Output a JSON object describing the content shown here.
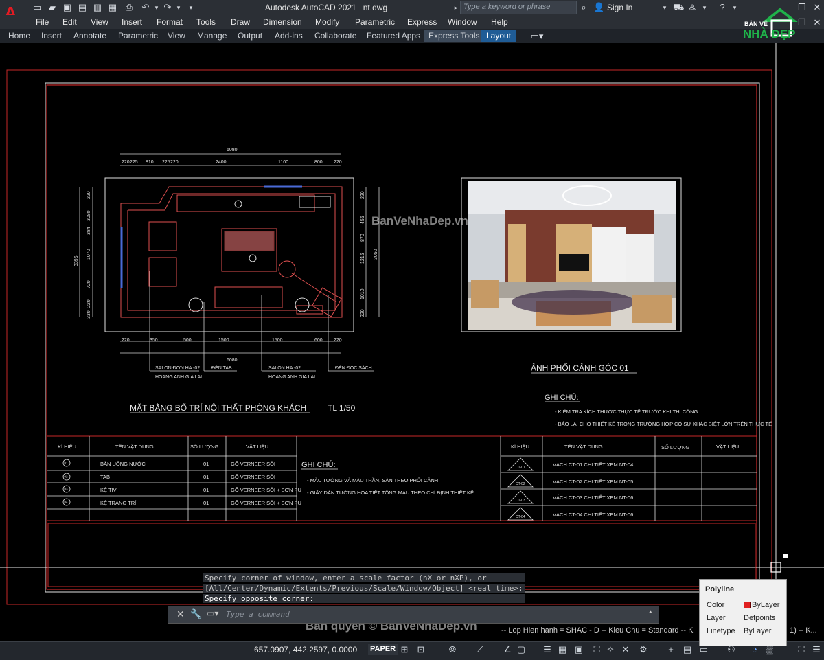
{
  "app": {
    "title": "Autodesk AutoCAD 2021   nt.dwg",
    "search_placeholder": "Type a keyword or phrase",
    "sign_in": "Sign In",
    "logo_letter": "A"
  },
  "menu": [
    "File",
    "Edit",
    "View",
    "Insert",
    "Format",
    "Tools",
    "Draw",
    "Dimension",
    "Modify",
    "Parametric",
    "Express",
    "Window",
    "Help"
  ],
  "ribbon_tabs": [
    "Home",
    "Insert",
    "Annotate",
    "Parametric",
    "View",
    "Manage",
    "Output",
    "Add-ins",
    "Collaborate",
    "Featured Apps",
    "Express Tools",
    "Layout"
  ],
  "drawing": {
    "top_dim": "6080",
    "bottom_dim": "6080",
    "top_dims": [
      "220",
      "225",
      "810",
      "225",
      "220",
      "2400",
      "1100",
      "800",
      "220"
    ],
    "bottom_dims": [
      "220",
      "350",
      "500",
      "1500",
      "1500",
      "600",
      "220"
    ],
    "left_dim": "3395",
    "left_dims": [
      "220",
      "3080",
      "384",
      "1070",
      "720",
      "220",
      "330"
    ],
    "right_dims": [
      "220",
      "455",
      "870",
      "1215",
      "1010",
      "220"
    ],
    "right_total": "3050",
    "callouts": [
      {
        "l1": "SALON ĐƠN HA -02",
        "l2": "HOANG ANH GIA LAI"
      },
      {
        "l1": "ĐÈN TAB",
        "l2": ""
      },
      {
        "l1": "SALON HA -02",
        "l2": "HOANG ANH GIA LAI"
      },
      {
        "l1": "ĐÈN ĐỌC SÁCH",
        "l2": ""
      }
    ],
    "plan_title": "MẶT BẰNG BỐ TRÍ NỘI THẤT PHÒNG KHÁCH",
    "plan_scale": "TL 1/50",
    "photo_title": "ẢNH PHỐI CẢNH GÓC 01",
    "note_title": "GHI CHÚ:",
    "notes_right": [
      "- KIỂM TRA KÍCH THƯỚC THỰC TẾ TRƯỚC KHI THI CÔNG",
      "- BÁO LẠI CHO THIẾT KẾ TRONG TRƯỜNG HỢP CÓ SỰ KHÁC BIỆT LỚN TRÊN THỰC TẾ"
    ],
    "notes_mid": [
      "- MÀU TƯỜNG VÀ MÀU TRẦN, SÀN THEO PHỐI CẢNH",
      "- GIẤY DÁN TƯỜNG HỌA TIẾT TÔNG MÀU THEO CHỈ ĐỊNH THIẾT KẾ"
    ],
    "table1_headers": [
      "KÍ HIỆU",
      "TÊN VẬT DỤNG",
      "SỐ LƯỢNG",
      "VẬT LIỆU"
    ],
    "table1_rows": [
      {
        "sym": "01",
        "name": "BÀN UỐNG NƯỚC",
        "qty": "01",
        "mat": "GỖ VERNEER SỒI"
      },
      {
        "sym": "02",
        "name": "TAB",
        "qty": "01",
        "mat": "GỖ VERNEER SỒI"
      },
      {
        "sym": "03",
        "name": "KỆ TIVI",
        "qty": "01",
        "mat": "GỖ VERNEER SỒI + SƠN PU"
      },
      {
        "sym": "04",
        "name": "KỆ TRANG TRÍ",
        "qty": "01",
        "mat": "GỖ VERNEER SỒI + SƠN PU"
      }
    ],
    "table2_headers": [
      "KÍ HIỆU",
      "TÊN VẬT DỤNG",
      "SỐ LƯỢNG",
      "VẬT LIỆU"
    ],
    "table2_rows": [
      {
        "sym": "CT-01",
        "name": "VÁCH CT-01 CHI TIẾT XEM NT-04"
      },
      {
        "sym": "CT-02",
        "name": "VÁCH CT-02 CHI TIẾT XEM NT-05"
      },
      {
        "sym": "CT-03",
        "name": "VÁCH CT-03 CHI TIẾT XEM NT-06"
      },
      {
        "sym": "CT-04",
        "name": "VÁCH CT-04 CHI TIẾT XEM NT-06"
      }
    ]
  },
  "watermark1": "BanVeNhaDep.vn",
  "watermark2": "Bản quyền © BanVeNhaDep.vn",
  "logo": {
    "l1": "BẢN VẼ",
    "l2": "NHÀ ĐẸP"
  },
  "command": {
    "line1": "Specify corner of window, enter a scale factor (nX or nXP), or",
    "line2": "[All/Center/Dynamic/Extents/Previous/Scale/Window/Object] <real time>:",
    "line3": "Specify opposite corner:",
    "placeholder": "Type a command"
  },
  "status": {
    "strip": "-- Lop Hien hanh = SHAC - D -- Kieu Chu = Standard -- K",
    "strip_end": "1) -- K...",
    "coords": "657.0907, 442.2597, 0.0000",
    "paper": "PAPER"
  },
  "props": {
    "title": "Polyline",
    "rows": [
      {
        "k": "Color",
        "v": "ByLayer"
      },
      {
        "k": "Layer",
        "v": "Defpoints"
      },
      {
        "k": "Linetype",
        "v": "ByLayer"
      }
    ]
  }
}
